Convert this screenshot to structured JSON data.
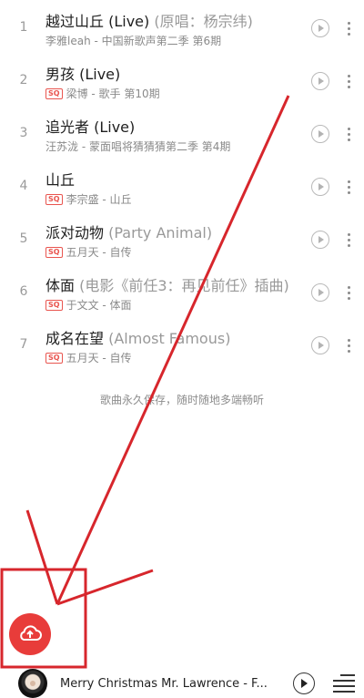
{
  "songs": [
    {
      "index": "1",
      "title": "越过山丘 (Live)",
      "title_extra": " (原唱：杨宗纬)",
      "sq": false,
      "subtitle": "李雅leah - 中国新歌声第二季 第6期"
    },
    {
      "index": "2",
      "title": "男孩 (Live)",
      "title_extra": "",
      "sq": true,
      "sq_label": "SQ",
      "subtitle": "梁博 - 歌手 第10期"
    },
    {
      "index": "3",
      "title": "追光者 (Live)",
      "title_extra": "",
      "sq": false,
      "subtitle": "汪苏泷 - 蒙面唱将猜猜猜第二季 第4期"
    },
    {
      "index": "4",
      "title": "山丘",
      "title_extra": "",
      "sq": true,
      "sq_label": "SQ",
      "subtitle": "李宗盛 - 山丘"
    },
    {
      "index": "5",
      "title": "派对动物",
      "title_extra": " (Party Animal)",
      "sq": true,
      "sq_label": "SQ",
      "subtitle": "五月天 - 自传"
    },
    {
      "index": "6",
      "title": "体面",
      "title_extra": " (电影《前任3：再见前任》插曲)",
      "sq": true,
      "sq_label": "SQ",
      "subtitle": "于文文 - 体面"
    },
    {
      "index": "7",
      "title": "成名在望",
      "title_extra": " (Almost Famous)",
      "sq": true,
      "sq_label": "SQ",
      "subtitle": "五月天 - 自传"
    }
  ],
  "footer_note": "歌曲永久保存，随时随地多端畅听",
  "player": {
    "track": "Merry Christmas Mr. Lawrence - F..."
  },
  "icons": {
    "mv": "play-circle-icon",
    "more": "more-vertical-icon",
    "upload": "cloud-upload-icon",
    "play": "play-icon",
    "playlist": "playlist-icon"
  },
  "colors": {
    "accent": "#e83c3a",
    "annotation": "#d7262c"
  }
}
